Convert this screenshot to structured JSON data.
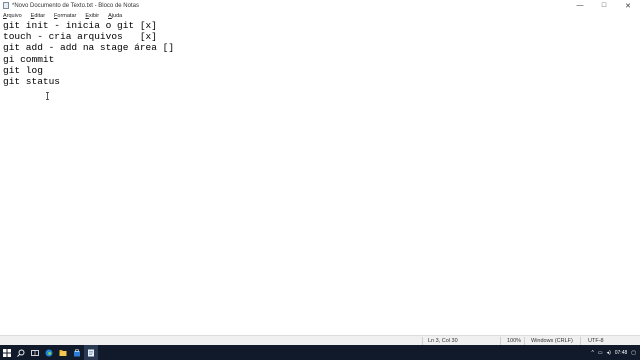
{
  "window": {
    "title": "*Novo Documento de Texto.txt - Bloco de Notas",
    "minimize_glyph": "—",
    "maximize_glyph": "□",
    "close_glyph": "✕"
  },
  "menu": {
    "items": [
      {
        "first": "A",
        "rest": "rquivo"
      },
      {
        "first": "E",
        "rest": "ditar"
      },
      {
        "first": "F",
        "rest": "ormatar"
      },
      {
        "first": "E",
        "rest": "xibir"
      },
      {
        "first": "A",
        "rest": "juda"
      }
    ]
  },
  "document": {
    "lines": [
      "git init - inicia o git [x]",
      "touch - cria arquivos   [x]",
      "git add - add na stage área []",
      "gi commit",
      "git log",
      "git status"
    ]
  },
  "status": {
    "position": "Ln 3, Col 30",
    "zoom": "100%",
    "line_ending": "Windows (CRLF)",
    "encoding": "UTF-8"
  },
  "taskbar": {
    "icons": [
      "windows-start-icon",
      "search-icon",
      "task-view-icon",
      "edge-icon",
      "explorer-icon",
      "store-icon",
      "notepad-icon"
    ],
    "time": "07:48"
  },
  "colors": {
    "taskbar": "#101a2a",
    "statusbar": "#f0f0f0"
  }
}
